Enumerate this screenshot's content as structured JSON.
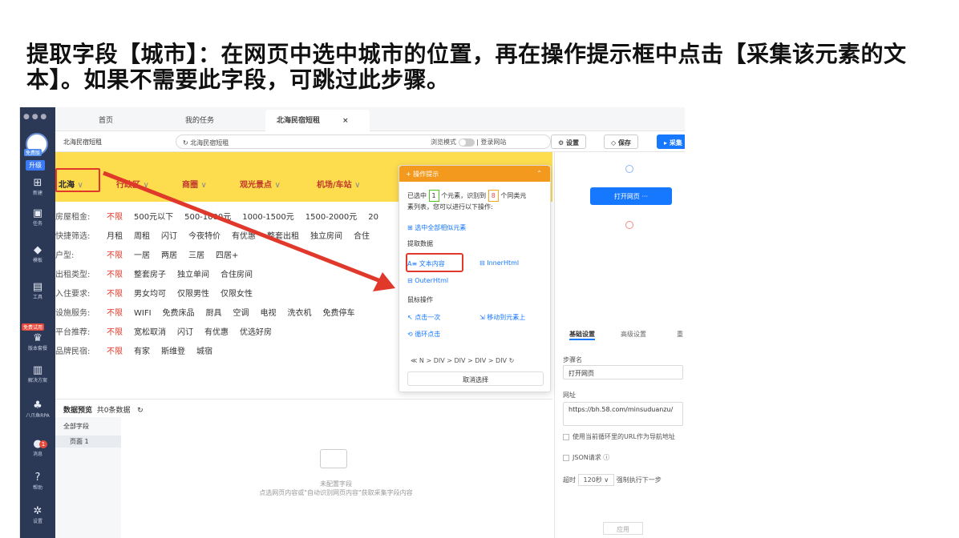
{
  "caption": "提取字段【城市】：在网页中选中城市的位置，再在操作提示框中点击【采集该元素的文本】。如果不需要此字段，可跳过此步骤。",
  "nav": {
    "free_badge": "免费版",
    "upgrade": "升级",
    "items": [
      "新建",
      "任务",
      "模板",
      "工具",
      "版本套餐",
      "解决方案",
      "八爪鱼RPA",
      "消息",
      "帮助",
      "设置"
    ],
    "trial": "免费试用",
    "msg_count": "1"
  },
  "tabs": {
    "home": "首页",
    "mytask": "我的任务",
    "active": "北海民宿短租",
    "close": "×"
  },
  "addressbar": {
    "title": "北海民宿短租",
    "url": "北海民宿短租",
    "browse_mode": "浏览模式",
    "login": "登录网站",
    "settings": "设置",
    "save": "保存",
    "collect": "采集"
  },
  "web": {
    "filters": [
      "北海",
      "行政区",
      "商圈",
      "观光景点",
      "机场/车站"
    ],
    "rows": [
      {
        "label": "房屋租金:",
        "items": [
          "不限",
          "500元以下",
          "500-1000元",
          "1000-1500元",
          "1500-2000元",
          "20"
        ]
      },
      {
        "label": "快捷筛选:",
        "items": [
          "月租",
          "周租",
          "闪订",
          "今夜特价",
          "有优惠",
          "整套出租",
          "独立房间",
          "合住"
        ]
      },
      {
        "label": "户型:",
        "items": [
          "不限",
          "一居",
          "两居",
          "三居",
          "四居+"
        ]
      },
      {
        "label": "出租类型:",
        "items": [
          "不限",
          "整套房子",
          "独立单间",
          "合住房间"
        ]
      },
      {
        "label": "入住要求:",
        "items": [
          "不限",
          "男女均可",
          "仅限男性",
          "仅限女性"
        ]
      },
      {
        "label": "设施服务:",
        "items": [
          "不限",
          "WIFI",
          "免费床品",
          "厨具",
          "空调",
          "电视",
          "洗衣机",
          "免费停车"
        ]
      },
      {
        "label": "平台推荐:",
        "items": [
          "不限",
          "宽松取消",
          "闪订",
          "有优惠",
          "优选好房"
        ]
      },
      {
        "label": "品牌民宿:",
        "items": [
          "不限",
          "有家",
          "斯维登",
          "城宿"
        ]
      }
    ]
  },
  "popup": {
    "title": "操作提示",
    "line1a": "已选中",
    "selected": "1",
    "line1b": "个元素，识别到",
    "similar": "8",
    "line1c": "个同类元",
    "line2": "素列表，您可以进行以下操作:",
    "select_all": "选中全部相似元素",
    "extract": "提取数据",
    "text": "文本内容",
    "innerhtml": "InnerHtml",
    "outerhtml": "OuterHtml",
    "mouse": "鼠标操作",
    "click": "点击一次",
    "hover": "移动到元素上",
    "loop": "循环点击",
    "crumb": "≪ N > DIV > DIV > DIV > DIV ↻",
    "cancel": "取消选择"
  },
  "preview": {
    "title": "数据预览",
    "count": "共0条数据",
    "all_fields": "全部字段",
    "page1": "页面 1",
    "empty": "未配置字段",
    "hint": "点选网页内容或\"自动识别网页内容\"获取采集字段内容"
  },
  "panel": {
    "open_page": "打开网页",
    "tab_basic": "基础设置",
    "tab_adv": "高级设置",
    "tab_more": "重",
    "step_name_label": "步骤名",
    "step_name": "打开网页",
    "url_label": "网址",
    "url": "https://bh.58.com/minsuduanzu/",
    "use_loop_url": "使用当前循环里的URL作为导航地址",
    "json_req": "JSON请求",
    "timeout_label": "超时",
    "timeout": "120秒",
    "force_next": "强制执行下一步",
    "apply": "应用"
  }
}
